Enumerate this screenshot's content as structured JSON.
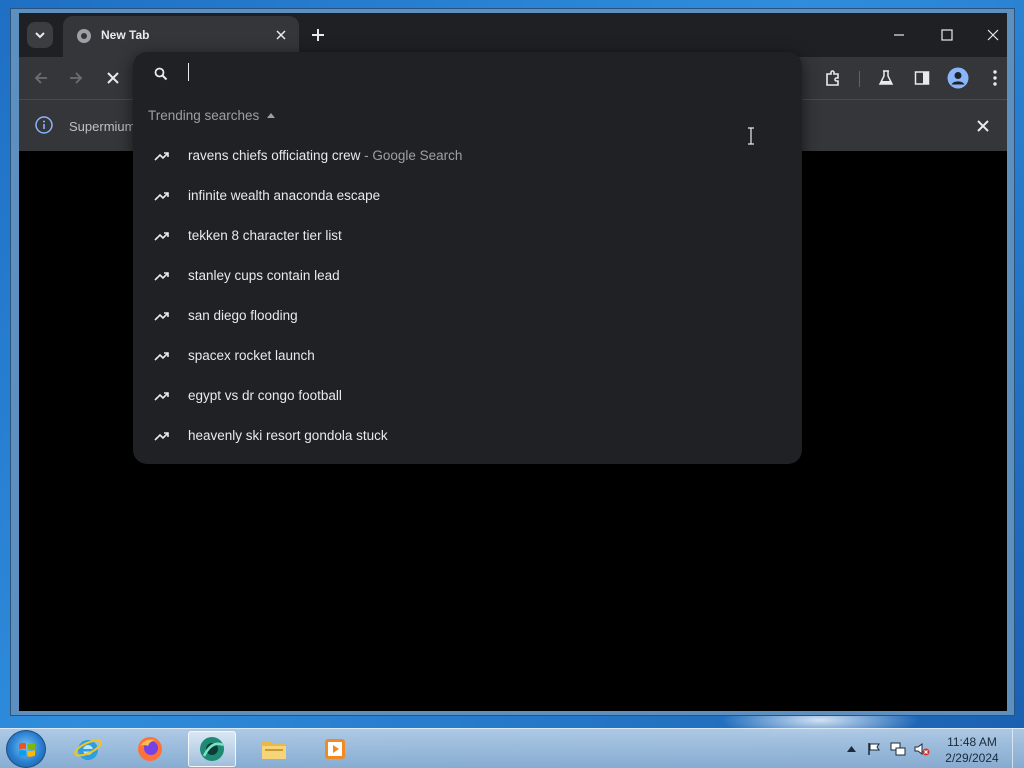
{
  "browser": {
    "tab": {
      "title": "New Tab"
    },
    "infobar": {
      "text": "Supermium"
    }
  },
  "omnibox": {
    "value": "",
    "placeholder": "",
    "trending_header": "Trending searches",
    "suggestions": [
      {
        "text": "ravens chiefs officiating crew",
        "sub": " - Google Search"
      },
      {
        "text": "infinite wealth anaconda escape",
        "sub": ""
      },
      {
        "text": "tekken 8 character tier list",
        "sub": ""
      },
      {
        "text": "stanley cups contain lead",
        "sub": ""
      },
      {
        "text": "san diego flooding",
        "sub": ""
      },
      {
        "text": "spacex rocket launch",
        "sub": ""
      },
      {
        "text": "egypt vs dr congo football",
        "sub": ""
      },
      {
        "text": "heavenly ski resort gondola stuck",
        "sub": ""
      }
    ]
  },
  "taskbar": {
    "clock": {
      "time": "11:48 AM",
      "date": "2/29/2024"
    },
    "apps": [
      "internet-explorer",
      "firefox",
      "supermium",
      "file-explorer",
      "media-player"
    ]
  },
  "colors": {
    "omnibox_bg": "#202124",
    "toolbar_bg": "#35363a",
    "titlebar_bg": "#1f2023",
    "text_primary": "#e8eaed",
    "text_secondary": "#9aa0a6",
    "info_accent": "#8ab4f8"
  }
}
